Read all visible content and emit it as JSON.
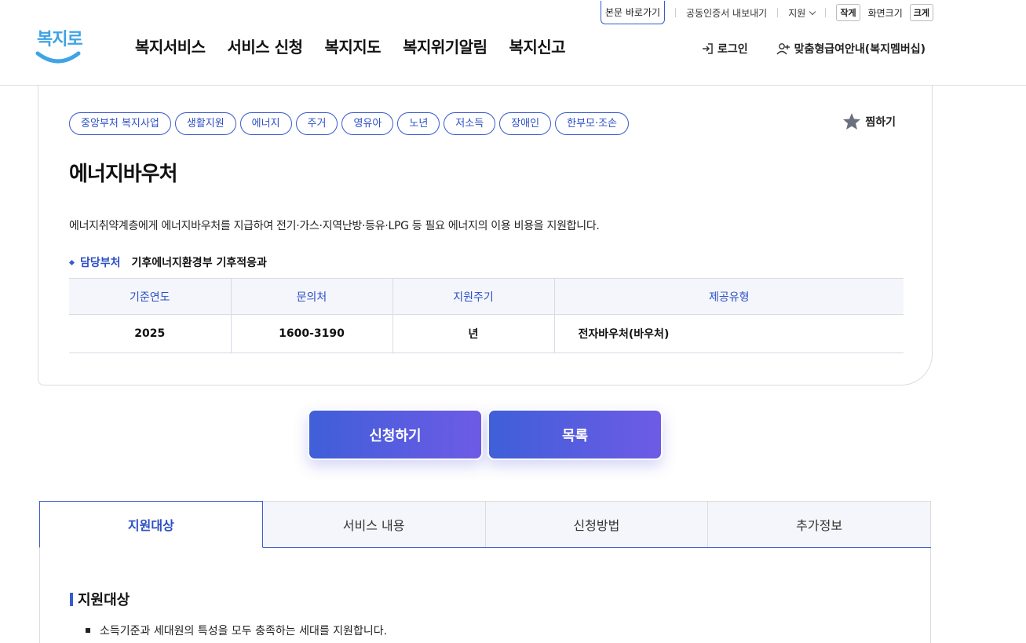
{
  "utility": {
    "skip_link": "본문 바로가기",
    "certificate": "공동인증서 내보내기",
    "support": "지원",
    "size_small": "작게",
    "size_label": "화면크기",
    "size_large": "크게"
  },
  "logo": {
    "text": "복지로"
  },
  "gnb": [
    "복지서비스",
    "서비스 신청",
    "복지지도",
    "복지위기알림",
    "복지신고"
  ],
  "member": {
    "login": "로그인",
    "membership": "맞춤형급여안내(복지멤버십)"
  },
  "service": {
    "tags": [
      "중앙부처 복지사업",
      "생활지원",
      "에너지",
      "주거",
      "영유아",
      "노년",
      "저소득",
      "장애인",
      "한부모·조손"
    ],
    "favorite": "찜하기",
    "title": "에너지바우처",
    "description": "에너지취약계층에게 에너지바우처를 지급하여 전기·가스·지역난방·등유·LPG 등 필요 에너지의 이용 비용을 지원합니다.",
    "dept_label": "담당부처",
    "dept_value": "기후에너지환경부 기후적응과",
    "table": {
      "headers": [
        "기준연도",
        "문의처",
        "지원주기",
        "제공유형"
      ],
      "row": [
        "2025",
        "1600-3190",
        "년",
        "전자바우처(바우처)"
      ]
    }
  },
  "actions": {
    "apply": "신청하기",
    "list": "목록"
  },
  "tabs": [
    "지원대상",
    "서비스 내용",
    "신청방법",
    "추가정보"
  ],
  "panel": {
    "title": "지원대상",
    "items": [
      "소득기준과 세대원의 특성을 모두 충족하는 세대를 지원합니다."
    ]
  },
  "colors": {
    "accent": "#3a5ad0",
    "button_gradient_start": "#3f5fd8",
    "button_gradient_end": "#6e5be6",
    "logo": "#3ea4e6"
  },
  "icons": {
    "login": "login-icon",
    "membership": "user-plus-icon",
    "favorite": "star-icon",
    "support_dropdown": "chevron-down-icon"
  }
}
